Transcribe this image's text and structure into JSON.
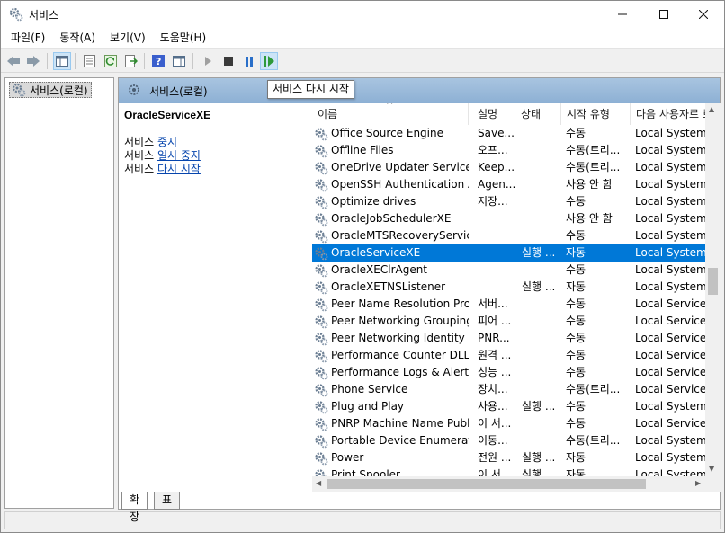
{
  "window": {
    "title": "서비스"
  },
  "menu": [
    "파일(F)",
    "동작(A)",
    "보기(V)",
    "도움말(H)"
  ],
  "tree": {
    "root_label": "서비스(로컬)"
  },
  "header": {
    "title": "서비스(로컬)"
  },
  "tooltip": "서비스 다시 시작",
  "detail": {
    "service_name": "OracleServiceXE",
    "links": [
      {
        "prefix": "서비스 ",
        "link": "중지"
      },
      {
        "prefix": "서비스 ",
        "link": "일시 중지"
      },
      {
        "prefix": "서비스 ",
        "link": "다시 시작"
      }
    ]
  },
  "grid": {
    "columns": [
      "이름",
      "설명",
      "상태",
      "시작 유형",
      "다음 사용자로 로그온"
    ],
    "rows": [
      {
        "name": "Office  Source Engine",
        "desc": "Save...",
        "status": "",
        "startup": "수동",
        "logon": "Local System",
        "selected": false
      },
      {
        "name": "Offline Files",
        "desc": "오프...",
        "status": "",
        "startup": "수동(트리...",
        "logon": "Local System",
        "selected": false
      },
      {
        "name": "OneDrive Updater Service",
        "desc": "Keep...",
        "status": "",
        "startup": "수동(트리...",
        "logon": "Local System",
        "selected": false
      },
      {
        "name": "OpenSSH Authentication A...",
        "desc": "Agen...",
        "status": "",
        "startup": "사용 안 함",
        "logon": "Local System",
        "selected": false
      },
      {
        "name": "Optimize drives",
        "desc": "저장...",
        "status": "",
        "startup": "수동",
        "logon": "Local System",
        "selected": false
      },
      {
        "name": "OracleJobSchedulerXE",
        "desc": "",
        "status": "",
        "startup": "사용 안 함",
        "logon": "Local System",
        "selected": false
      },
      {
        "name": "OracleMTSRecoveryService",
        "desc": "",
        "status": "",
        "startup": "수동",
        "logon": "Local System",
        "selected": false
      },
      {
        "name": "OracleServiceXE",
        "desc": "",
        "status": "실행 ...",
        "startup": "자동",
        "logon": "Local System",
        "selected": true
      },
      {
        "name": "OracleXEClrAgent",
        "desc": "",
        "status": "",
        "startup": "수동",
        "logon": "Local System",
        "selected": false
      },
      {
        "name": "OracleXETNSListener",
        "desc": "",
        "status": "실행 ...",
        "startup": "자동",
        "logon": "Local System",
        "selected": false
      },
      {
        "name": "Peer Name Resolution Prot...",
        "desc": "서버...",
        "status": "",
        "startup": "수동",
        "logon": "Local Service",
        "selected": false
      },
      {
        "name": "Peer Networking Grouping",
        "desc": "피어 ...",
        "status": "",
        "startup": "수동",
        "logon": "Local Service",
        "selected": false
      },
      {
        "name": "Peer Networking Identity ...",
        "desc": "PNR...",
        "status": "",
        "startup": "수동",
        "logon": "Local Service",
        "selected": false
      },
      {
        "name": "Performance Counter DLL ...",
        "desc": "원격 ...",
        "status": "",
        "startup": "수동",
        "logon": "Local Service",
        "selected": false
      },
      {
        "name": "Performance Logs & Alerts",
        "desc": "성능 ...",
        "status": "",
        "startup": "수동",
        "logon": "Local Service",
        "selected": false
      },
      {
        "name": "Phone Service",
        "desc": "장치...",
        "status": "",
        "startup": "수동(트리...",
        "logon": "Local Service",
        "selected": false
      },
      {
        "name": "Plug and Play",
        "desc": "사용...",
        "status": "실행 ...",
        "startup": "수동",
        "logon": "Local System",
        "selected": false
      },
      {
        "name": "PNRP Machine Name Publi...",
        "desc": "이 서...",
        "status": "",
        "startup": "수동",
        "logon": "Local Service",
        "selected": false
      },
      {
        "name": "Portable Device Enumerato...",
        "desc": "이동...",
        "status": "",
        "startup": "수동(트리...",
        "logon": "Local System",
        "selected": false
      },
      {
        "name": "Power",
        "desc": "전원 ...",
        "status": "실행 ...",
        "startup": "자동",
        "logon": "Local System",
        "selected": false
      },
      {
        "name": "Print Spooler",
        "desc": "이 서...",
        "status": "실행 ...",
        "startup": "자동",
        "logon": "Local System",
        "selected": false
      }
    ]
  },
  "tabs": [
    "확장",
    "표준"
  ],
  "colors": {
    "selection": "#0078d7",
    "header_bg": "#99bbdd",
    "link": "#0645ad"
  }
}
